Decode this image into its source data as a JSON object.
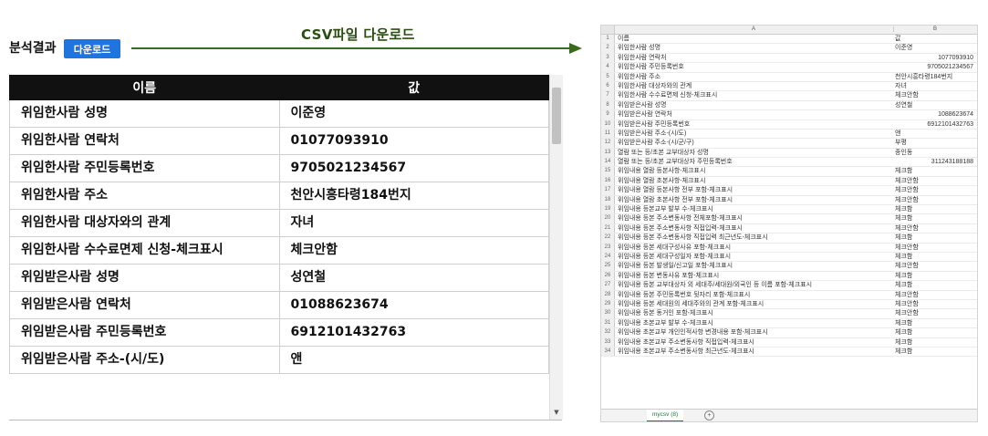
{
  "header": {
    "title": "분석결과",
    "download_button": "다운로드",
    "arrow_label": "CSV파일 다운로드"
  },
  "table": {
    "columns": [
      "이름",
      "값"
    ],
    "rows": [
      {
        "key": "위임한사람 성명",
        "value": "이준영"
      },
      {
        "key": "위임한사람 연락처",
        "value": "01077093910"
      },
      {
        "key": "위임한사람 주민등록번호",
        "value": "9705021234567"
      },
      {
        "key": "위임한사람 주소",
        "value": "천안시흥타령184번지"
      },
      {
        "key": "위임한사람 대상자와의 관계",
        "value": "자녀"
      },
      {
        "key": "위임한사람 수수료면제 신청-체크표시",
        "value": "체크안함"
      },
      {
        "key": "위임받은사람 성명",
        "value": "성연철"
      },
      {
        "key": "위임받은사람 연락처",
        "value": "01088623674"
      },
      {
        "key": "위임받은사람 주민등록번호",
        "value": "6912101432763"
      },
      {
        "key": "위임받은사람 주소-(시/도)",
        "value": "앤"
      }
    ]
  },
  "sheet": {
    "col_a": "A",
    "col_b": "B",
    "tab_label": "mycsv (8)",
    "add_tab": "+",
    "rows": [
      {
        "n": "1",
        "a": "이름",
        "b": "값"
      },
      {
        "n": "2",
        "a": "위임한사람 성명",
        "b": "이준영"
      },
      {
        "n": "3",
        "a": "위임한사람 연락처",
        "b": "1077093910",
        "num": true
      },
      {
        "n": "4",
        "a": "위임한사람 주민등록번호",
        "b": "9705021234567",
        "num": true
      },
      {
        "n": "5",
        "a": "위임한사람 주소",
        "b": "천안시흥타령184번지"
      },
      {
        "n": "6",
        "a": "위임한사람 대상자와의 관계",
        "b": "자녀"
      },
      {
        "n": "7",
        "a": "위임한사람 수수료면제 신청-체크표시",
        "b": "체크안함"
      },
      {
        "n": "8",
        "a": "위임받은사람 성명",
        "b": "성연철"
      },
      {
        "n": "9",
        "a": "위임받은사람 연락처",
        "b": "1088623674",
        "num": true
      },
      {
        "n": "10",
        "a": "위임받은사람 주민등록번호",
        "b": "6912101432763",
        "num": true
      },
      {
        "n": "11",
        "a": "위임받은사람 주소-(시/도)",
        "b": "앤"
      },
      {
        "n": "12",
        "a": "위임받은사람 주소-(시/군/구)",
        "b": "부평"
      },
      {
        "n": "13",
        "a": "열람 또는 등/초본 교부대상자 성명",
        "b": "종인동"
      },
      {
        "n": "14",
        "a": "열람 또는 등/초본 교부대상자 주민등록번호",
        "b": "311243188188",
        "num": true
      },
      {
        "n": "15",
        "a": "위임내용 열람 등본사항-체크표시",
        "b": "체크함"
      },
      {
        "n": "16",
        "a": "위임내용 열람 초본사항-체크표시",
        "b": "체크안함"
      },
      {
        "n": "17",
        "a": "위임내용 열람 등본사항 전부 포함-체크표시",
        "b": "체크안함"
      },
      {
        "n": "18",
        "a": "위임내용 열람 초본사항 전부 포함-체크표시",
        "b": "체크안함"
      },
      {
        "n": "19",
        "a": "위임내용 등본교부 발부 수-체크표시",
        "b": "체크함"
      },
      {
        "n": "20",
        "a": "위임내용 등본 주소변동사항 전체포함-체크표시",
        "b": "체크함"
      },
      {
        "n": "21",
        "a": "위임내용 등본 주소변동사항 직접입력-체크표시",
        "b": "체크안함"
      },
      {
        "n": "22",
        "a": "위임내용 등본 주소변동사항 직접입력 최근년도-체크표시",
        "b": "체크함"
      },
      {
        "n": "23",
        "a": "위임내용 등본 세대구성사유 포함-체크표시",
        "b": "체크안함"
      },
      {
        "n": "24",
        "a": "위임내용 등본 세대구성일자 포함-체크표시",
        "b": "체크함"
      },
      {
        "n": "25",
        "a": "위임내용 등본 발생일/신고일 포함-체크표시",
        "b": "체크안함"
      },
      {
        "n": "26",
        "a": "위임내용 등본 변동사유 포함-체크표시",
        "b": "체크함"
      },
      {
        "n": "27",
        "a": "위임내용 등본 교부대상자 외 세대주/세대원/외국인 등 이름 포함-체크표시",
        "b": "체크함"
      },
      {
        "n": "28",
        "a": "위임내용 등본 주민등록번호 뒷자리 포함-체크표시",
        "b": "체크안함"
      },
      {
        "n": "29",
        "a": "위임내용 등본 세대원의 세대주와의 관계 포함-체크표시",
        "b": "체크안함"
      },
      {
        "n": "30",
        "a": "위임내용 등본 동거인 포함-체크표시",
        "b": "체크안함"
      },
      {
        "n": "31",
        "a": "위임내용 초본교부 발부 수-체크표시",
        "b": "체크함"
      },
      {
        "n": "32",
        "a": "위임내용 초본교부 개인인적사항 변경내용 포함-체크표시",
        "b": "체크함"
      },
      {
        "n": "33",
        "a": "위임내용 초본교부 주소변동사항 직접입력-체크표시",
        "b": "체크함"
      },
      {
        "n": "34",
        "a": "위임내용 초본교부 주소변동사항 최근년도-체크표시",
        "b": "체크함"
      }
    ]
  }
}
